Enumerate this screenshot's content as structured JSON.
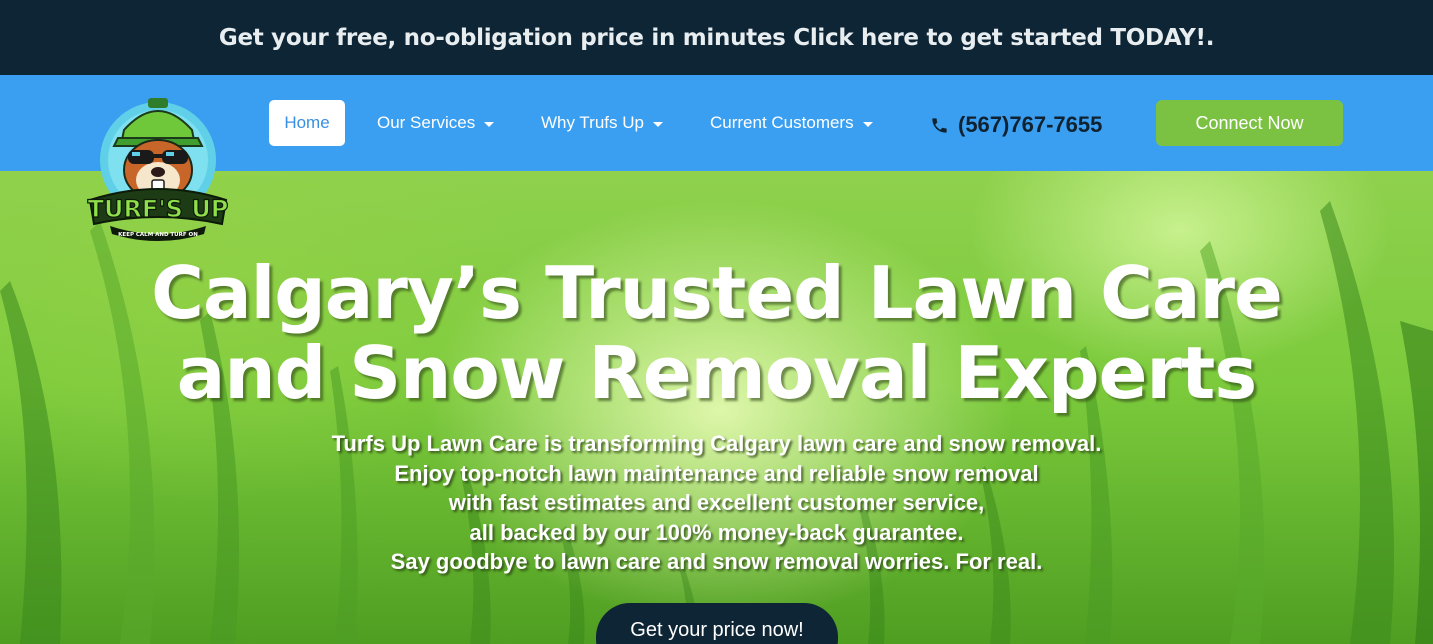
{
  "topbar": {
    "text": "Get your free, no-obligation price in minutes Click here to get started TODAY!."
  },
  "logo": {
    "brand_text": "TURF'S UP",
    "tagline": "KEEP CALM AND TURF ON"
  },
  "nav": {
    "items": [
      {
        "label": "Home",
        "active": true
      },
      {
        "label": "Our Services",
        "dropdown": true
      },
      {
        "label": "Why Trufs Up",
        "dropdown": true
      },
      {
        "label": "Current Customers",
        "dropdown": true
      }
    ],
    "phone": "(567)767-7655",
    "connect_label": "Connect Now"
  },
  "hero": {
    "title_line1": "Calgary’s Trusted Lawn Care",
    "title_line2": "and Snow Removal Experts",
    "subtitle_lines": [
      "Turfs Up Lawn Care is transforming Calgary lawn care and snow removal.",
      "Enjoy top-notch lawn maintenance and reliable snow removal",
      "with fast estimates and excellent customer service,",
      "all backed by our 100% money-back guarantee.",
      "Say goodbye to lawn care and snow removal worries. For real."
    ],
    "cta_label": "Get your price now!"
  },
  "colors": {
    "topbar_bg": "#0e2536",
    "nav_bg": "#3a9ff0",
    "connect_bg": "#7cc242",
    "cta_bg": "#0e2536"
  }
}
